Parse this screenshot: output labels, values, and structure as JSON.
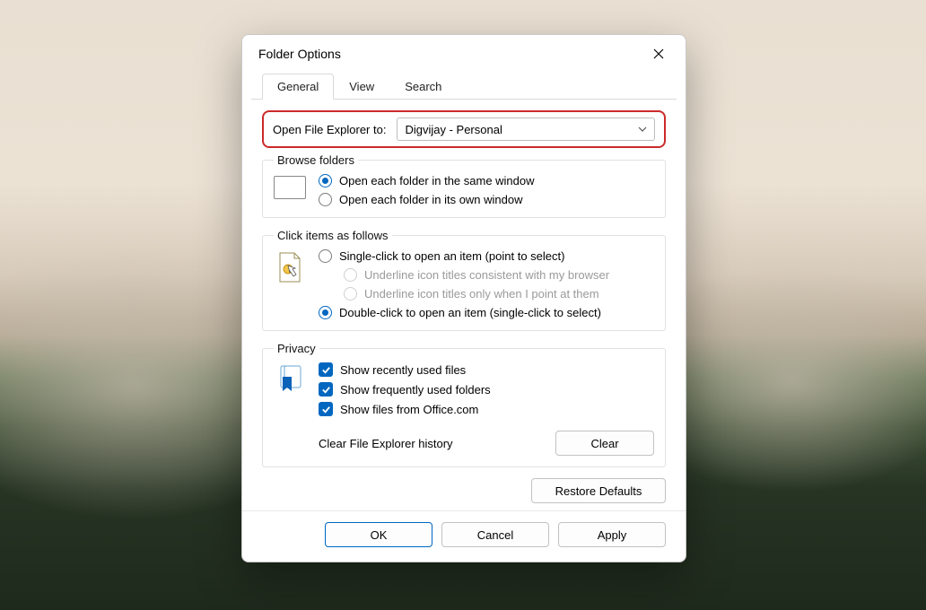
{
  "dialog": {
    "title": "Folder Options",
    "tabs": {
      "general": "General",
      "view": "View",
      "search": "Search"
    },
    "open_to": {
      "label": "Open File Explorer to:",
      "value": "Digvijay - Personal"
    },
    "browse": {
      "legend": "Browse folders",
      "same_window": "Open each folder in the same window",
      "own_window": "Open each folder in its own window"
    },
    "click": {
      "legend": "Click items as follows",
      "single": "Single-click to open an item (point to select)",
      "underline_browser": "Underline icon titles consistent with my browser",
      "underline_point": "Underline icon titles only when I point at them",
      "double": "Double-click to open an item (single-click to select)"
    },
    "privacy": {
      "legend": "Privacy",
      "recent_files": "Show recently used files",
      "frequent_folders": "Show frequently used folders",
      "office": "Show files from Office.com",
      "clear_label": "Clear File Explorer history",
      "clear_btn": "Clear"
    },
    "restore": "Restore Defaults",
    "buttons": {
      "ok": "OK",
      "cancel": "Cancel",
      "apply": "Apply"
    }
  }
}
